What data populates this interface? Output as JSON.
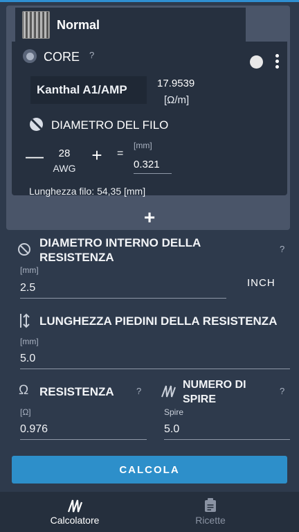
{
  "coil": {
    "name": "Normal",
    "core": {
      "label": "CORE",
      "help": "?",
      "wire_material": "Kanthal A1/AMP",
      "resistivity_value": "17.9539",
      "resistivity_unit": "[Ω/m]",
      "diameter_title": "DIAMETRO DEL FILO",
      "minus": "—",
      "awg_value": "28",
      "awg_unit": "AWG",
      "plus": "+",
      "equals": "=",
      "mm_label": "[mm]",
      "mm_value": "0.321",
      "wire_length": "Lunghezza filo: 54,35 [mm]"
    },
    "add_button": "+"
  },
  "form": {
    "inner_diameter": {
      "title_line1": "DIAMETRO INTERNO DELLA",
      "title_line2": "RESISTENZA",
      "help": "?",
      "unit": "[mm]",
      "value": "2.5",
      "unit_toggle": "INCH"
    },
    "leg_length": {
      "title": "LUNGHEZZA PIEDINI DELLA RESISTENZA",
      "unit": "[mm]",
      "value": "5.0"
    },
    "resistance": {
      "icon": "Ω",
      "title": "RESISTENZA",
      "help": "?",
      "unit": "[Ω]",
      "value": "0.976"
    },
    "wraps": {
      "title_line1": "NUMERO DI",
      "title_line2": "SPIRE",
      "help": "?",
      "unit": "Spire",
      "value": "5.0"
    },
    "calculate_button": "CALCOLA"
  },
  "bottom_nav": {
    "calculator": "Calcolatore",
    "recipes": "Ricette"
  },
  "colors": {
    "background": "#2e3a4c",
    "accent": "#2d8fca",
    "panel": "#26303f"
  }
}
